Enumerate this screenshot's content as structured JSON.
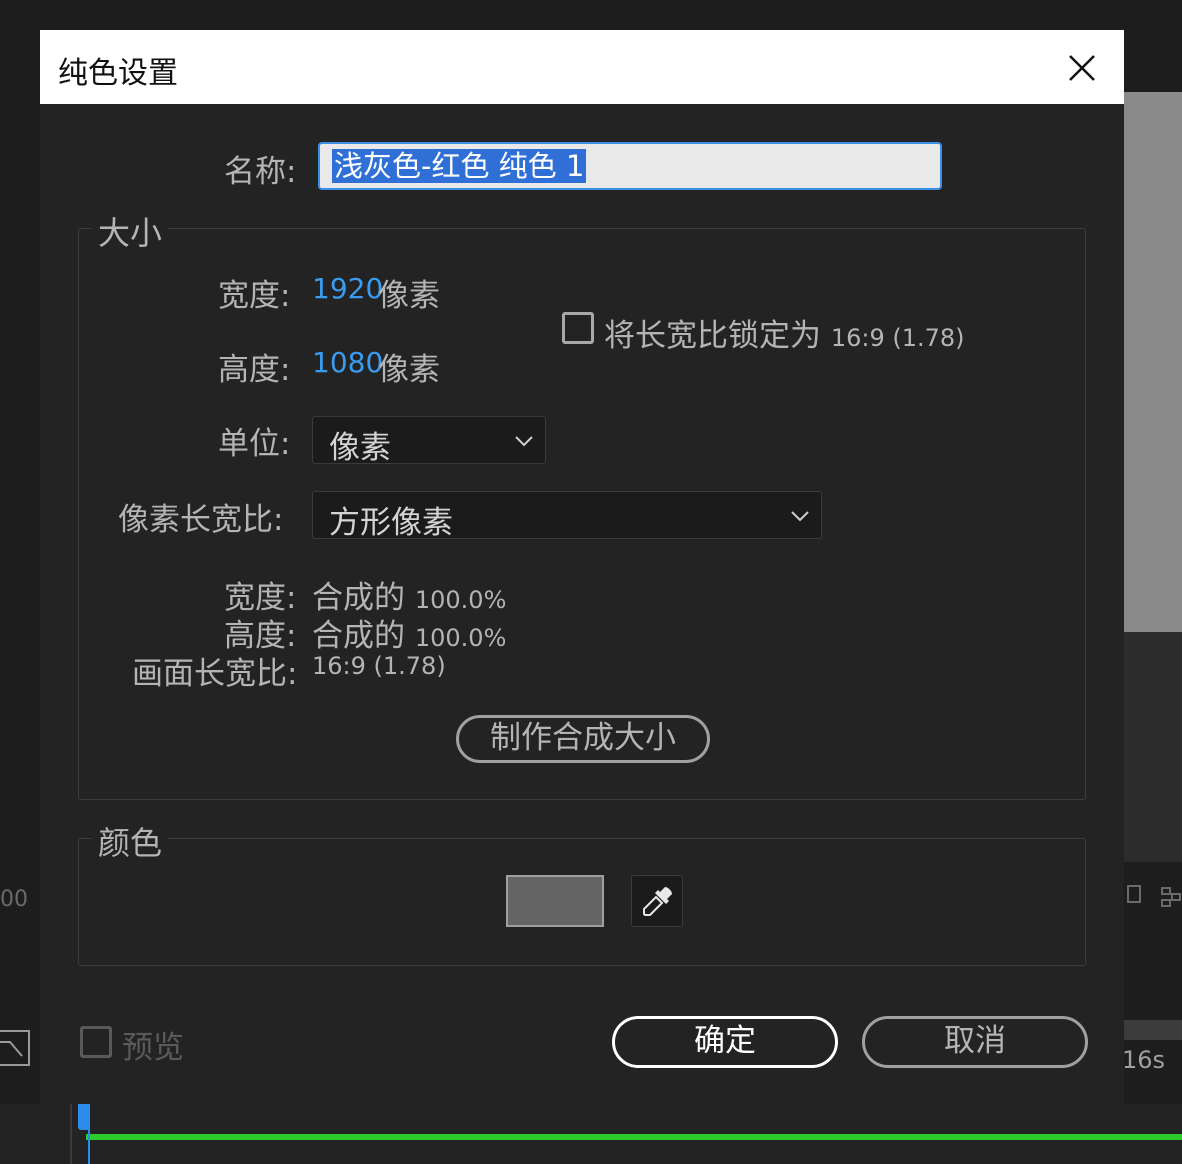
{
  "background": {
    "left_fragment": "00",
    "right_time_fragment": "16s"
  },
  "dialog": {
    "title": "纯色设置",
    "name_label": "名称:",
    "name_value": "浅灰色-红色 纯色 1",
    "size_group": {
      "title": "大小",
      "width_label": "宽度:",
      "width_value": "1920",
      "width_unit": "像素",
      "height_label": "高度:",
      "height_value": "1080",
      "height_unit": "像素",
      "lock_aspect_label": "将长宽比锁定为",
      "lock_aspect_value": "16:9 (1.78)",
      "lock_aspect_checked": false,
      "units_label": "单位:",
      "units_value": "像素",
      "pixel_aspect_label": "像素长宽比:",
      "pixel_aspect_value": "方形像素",
      "info_width_label": "宽度:",
      "info_width_prefix": "合成的",
      "info_width_value": "100.0%",
      "info_height_label": "高度:",
      "info_height_prefix": "合成的",
      "info_height_value": "100.0%",
      "frame_aspect_label": "画面长宽比:",
      "frame_aspect_value": "16:9 (1.78)",
      "make_comp_size_button": "制作合成大小"
    },
    "color_group": {
      "title": "颜色",
      "swatch_color": "#656565"
    },
    "preview_label": "预览",
    "preview_checked": false,
    "ok_button": "确定",
    "cancel_button": "取消"
  }
}
